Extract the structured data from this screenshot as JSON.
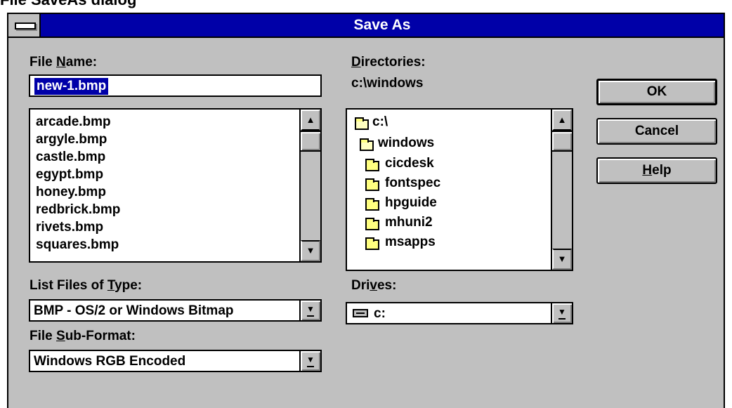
{
  "page_heading_fragment": "File SaveAs dialog",
  "window": {
    "title": "Save As"
  },
  "file_name": {
    "label_pre": "File ",
    "label_key": "N",
    "label_post": "ame:",
    "value": "new-1.bmp",
    "files": [
      "arcade.bmp",
      "argyle.bmp",
      "castle.bmp",
      "egypt.bmp",
      "honey.bmp",
      "redbrick.bmp",
      "rivets.bmp",
      "squares.bmp"
    ]
  },
  "directories": {
    "label_key": "D",
    "label_post": "irectories:",
    "current_path": "c:\\windows",
    "items": [
      {
        "name": "c:\\",
        "icon": "open-folder-icon"
      },
      {
        "name": "windows",
        "icon": "open-folder-icon"
      },
      {
        "name": "cicdesk",
        "icon": "folder-icon"
      },
      {
        "name": "fontspec",
        "icon": "folder-icon"
      },
      {
        "name": "hpguide",
        "icon": "folder-icon"
      },
      {
        "name": "mhuni2",
        "icon": "folder-icon"
      },
      {
        "name": "msapps",
        "icon": "folder-icon"
      }
    ]
  },
  "list_type": {
    "label_pre": "List Files of ",
    "label_key": "T",
    "label_post": "ype:",
    "value": "BMP - OS/2 or Windows Bitmap"
  },
  "drives": {
    "label_pre": "Dri",
    "label_key": "v",
    "label_post": "es:",
    "value": "c:"
  },
  "sub_format": {
    "label_pre": "File ",
    "label_key": "S",
    "label_post": "ub-Format:",
    "value": "Windows RGB Encoded"
  },
  "buttons": {
    "ok": "OK",
    "cancel": "Cancel",
    "help_key": "H",
    "help_post": "elp"
  },
  "scroll_glyphs": {
    "up": "▲",
    "down": "▼"
  },
  "colors": {
    "title_bar": "#0000a8",
    "face": "#c0c0c0",
    "selection": "#0000a8"
  }
}
